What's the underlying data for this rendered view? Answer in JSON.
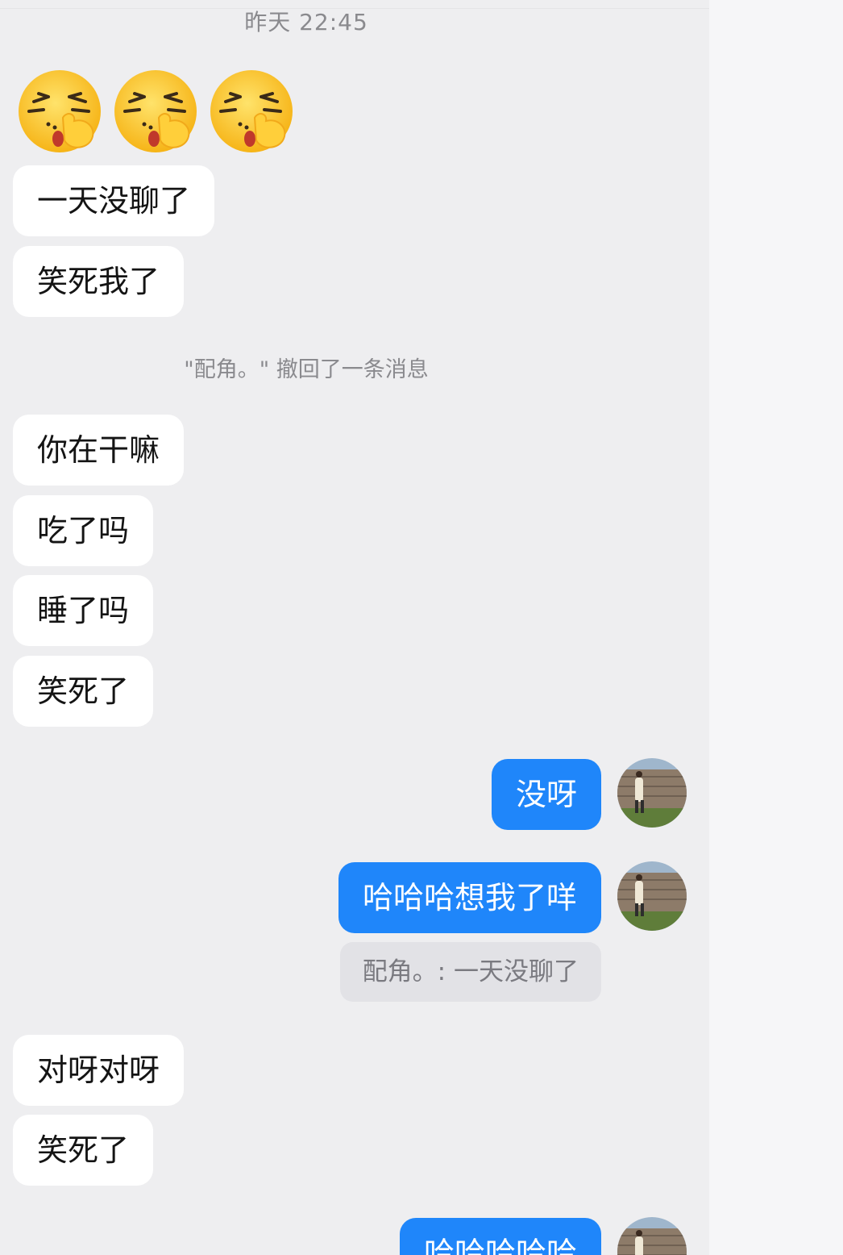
{
  "chat": {
    "timestamp": "昨天 22:45",
    "system_notice": "\"配角。\" 撤回了一条消息",
    "messages_in_1": [
      "一天没聊了",
      "笑死我了"
    ],
    "messages_in_2": [
      "你在干嘛",
      "吃了吗",
      "睡了吗",
      "笑死了"
    ],
    "messages_out": [
      "没呀",
      "哈哈哈想我了咩"
    ],
    "quote": "配角。:  一天没聊了",
    "messages_in_3": [
      "对呀对呀",
      "笑死了"
    ],
    "partial_out": "哈哈哈哈哈",
    "emoji_names": [
      "shush-face-emoji",
      "shush-face-emoji",
      "shush-face-emoji"
    ]
  },
  "colors": {
    "background": "#eeeef0",
    "incoming_bubble": "#ffffff",
    "outgoing_bubble": "#1f86fa",
    "quote_bubble": "#e2e2e6"
  }
}
